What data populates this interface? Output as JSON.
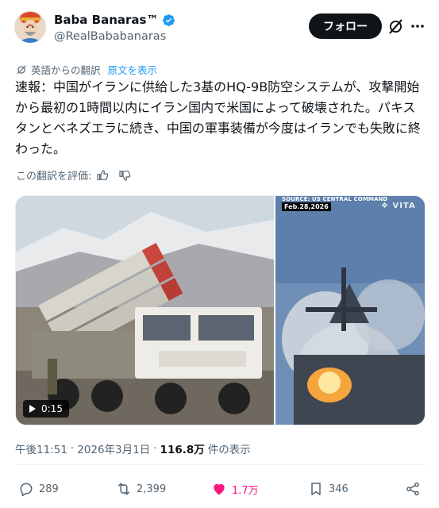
{
  "header": {
    "display_name": "Baba Banaras™",
    "handle": "@RealBababanaras",
    "follow_label": "フォロー"
  },
  "translation": {
    "translated_from": "英語からの翻訳",
    "show_original": "原文を表示"
  },
  "tweet": {
    "text": "速報：中国がイランに供給した3基のHQ-9B防空システムが、攻撃開始から最初の1時間以内にイラン国内で米国によって破壊された。パキスタンとベネズエラに続き、中国の軍事装備が今度はイランでも失敗に終わった。",
    "rate_translation": "この翻訳を評価:"
  },
  "media": {
    "source": "SOURCE: US CENTRAL COMMAND",
    "date": "Feb.28,2026",
    "watermark": "VITA",
    "duration": "0:15"
  },
  "meta": {
    "time": "午後11:51",
    "separator": "·",
    "date": "2026年3月1日",
    "views": "116.8万",
    "views_label": "件の表示"
  },
  "actions": {
    "replies": "289",
    "reposts": "2,399",
    "likes": "1.7万",
    "bookmarks": "346"
  },
  "colors": {
    "accent": "#1d9bf0",
    "like": "#f91880",
    "text": "#0f1419",
    "muted": "#536471"
  },
  "icons": [
    "verified-badge-icon",
    "grok-icon",
    "more-icon",
    "translate-icon",
    "thumbs-up-icon",
    "thumbs-down-icon",
    "play-icon",
    "reply-icon",
    "repost-icon",
    "like-icon",
    "bookmark-icon",
    "share-icon"
  ]
}
